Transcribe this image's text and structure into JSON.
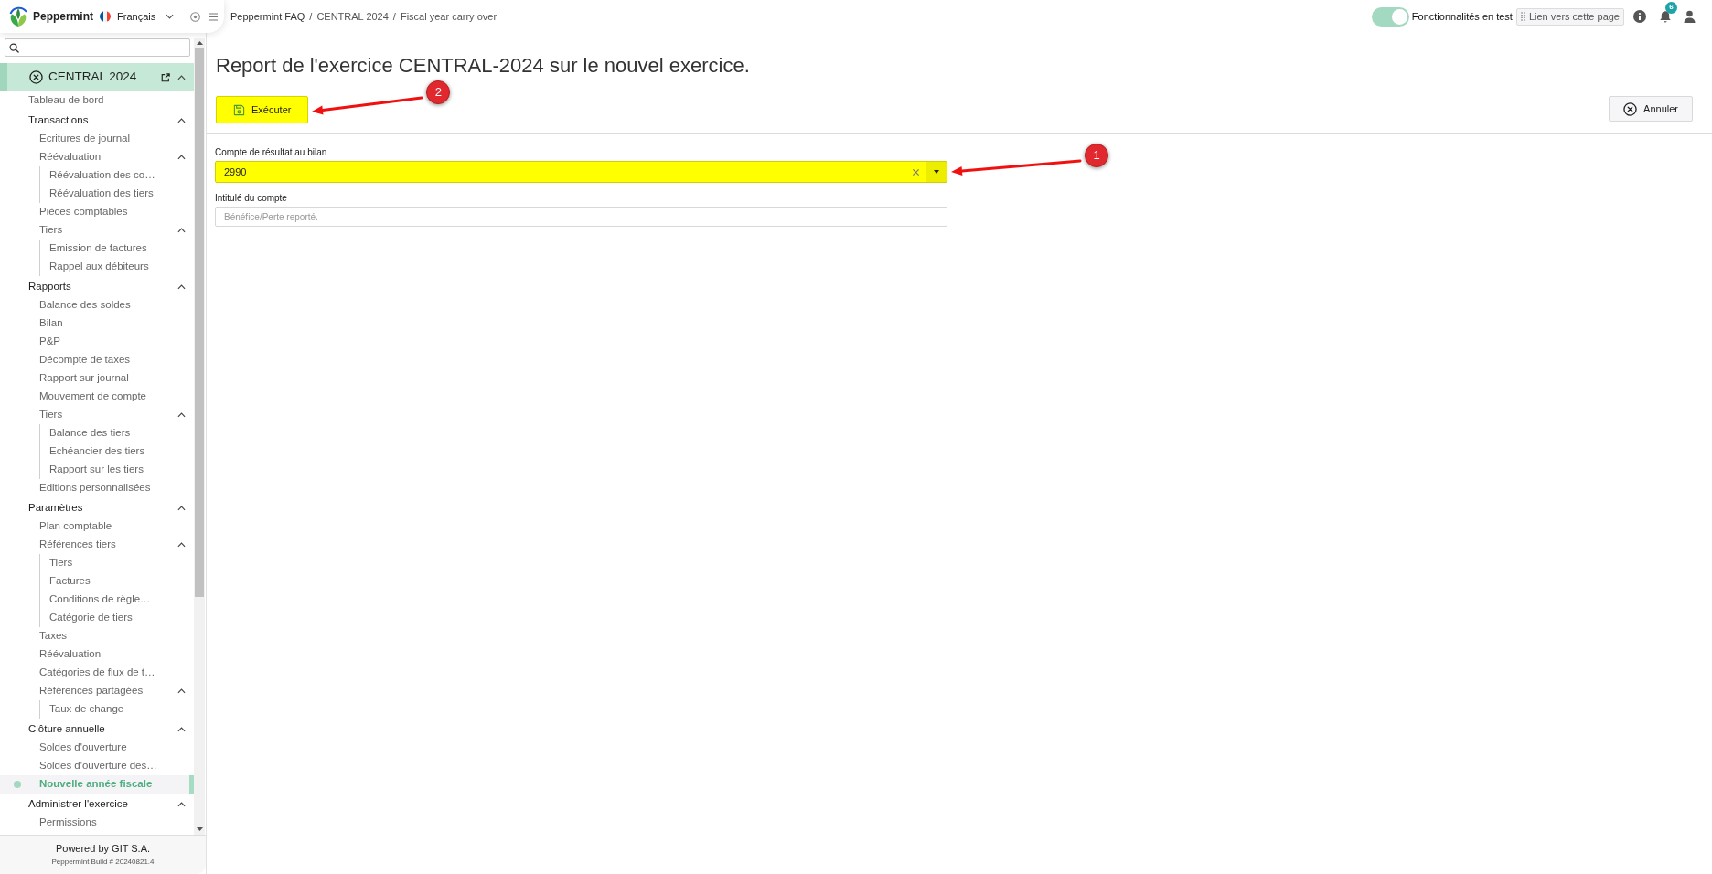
{
  "app": {
    "name": "Peppermint"
  },
  "language": {
    "label": "Français"
  },
  "breadcrumb": {
    "separator": "/",
    "items": [
      {
        "label": "Peppermint FAQ"
      },
      {
        "label": "CENTRAL 2024"
      },
      {
        "label": "Fiscal year carry over"
      }
    ]
  },
  "test_features": {
    "label": "Fonctionnalités en test",
    "on": true
  },
  "page_link": {
    "label": "Lien vers cette page"
  },
  "notifications": {
    "count": "6"
  },
  "sidebar": {
    "section": {
      "label": "CENTRAL 2024",
      "expanded": true,
      "children": [
        {
          "label": "Tableau de bord",
          "kind": "link",
          "selected": false
        },
        {
          "label": "Transactions",
          "kind": "group",
          "selected": false,
          "expanded": true,
          "children": [
            {
              "label": "Ecritures de journal",
              "kind": "link",
              "selected": false
            },
            {
              "label": "Réévaluation",
              "kind": "group",
              "selected": false,
              "expanded": true,
              "children": [
                {
                  "label": "Réévaluation des co…",
                  "kind": "link",
                  "selected": false
                },
                {
                  "label": "Réévaluation des tiers",
                  "kind": "link",
                  "selected": false
                }
              ]
            },
            {
              "label": "Pièces comptables",
              "kind": "link",
              "selected": false
            },
            {
              "label": "Tiers",
              "kind": "group",
              "selected": false,
              "expanded": true,
              "children": [
                {
                  "label": "Emission de factures",
                  "kind": "link",
                  "selected": false
                },
                {
                  "label": "Rappel aux débiteurs",
                  "kind": "link",
                  "selected": false
                }
              ]
            }
          ]
        },
        {
          "label": "Rapports",
          "kind": "group",
          "selected": false,
          "expanded": true,
          "children": [
            {
              "label": "Balance des soldes",
              "kind": "link",
              "selected": false
            },
            {
              "label": "Bilan",
              "kind": "link",
              "selected": false
            },
            {
              "label": "P&P",
              "kind": "link",
              "selected": false
            },
            {
              "label": "Décompte de taxes",
              "kind": "link",
              "selected": false
            },
            {
              "label": "Rapport sur journal",
              "kind": "link",
              "selected": false
            },
            {
              "label": "Mouvement de compte",
              "kind": "link",
              "selected": false
            },
            {
              "label": "Tiers",
              "kind": "group",
              "selected": false,
              "expanded": true,
              "children": [
                {
                  "label": "Balance des tiers",
                  "kind": "link",
                  "selected": false
                },
                {
                  "label": "Echéancier des tiers",
                  "kind": "link",
                  "selected": false
                },
                {
                  "label": "Rapport sur les tiers",
                  "kind": "link",
                  "selected": false
                }
              ]
            },
            {
              "label": "Editions personnalisées",
              "kind": "link",
              "selected": false
            }
          ]
        },
        {
          "label": "Paramètres",
          "kind": "group",
          "selected": false,
          "expanded": true,
          "children": [
            {
              "label": "Plan comptable",
              "kind": "link",
              "selected": false
            },
            {
              "label": "Références tiers",
              "kind": "group",
              "selected": false,
              "expanded": true,
              "children": [
                {
                  "label": "Tiers",
                  "kind": "link",
                  "selected": false
                },
                {
                  "label": "Factures",
                  "kind": "link",
                  "selected": false
                },
                {
                  "label": "Conditions de règle…",
                  "kind": "link",
                  "selected": false
                },
                {
                  "label": "Catégorie de tiers",
                  "kind": "link",
                  "selected": false
                }
              ]
            },
            {
              "label": "Taxes",
              "kind": "link",
              "selected": false
            },
            {
              "label": "Réévaluation",
              "kind": "link",
              "selected": false
            },
            {
              "label": "Catégories de flux de t…",
              "kind": "link",
              "selected": false
            },
            {
              "label": "Références partagées",
              "kind": "group",
              "selected": false,
              "expanded": true,
              "children": [
                {
                  "label": "Taux de change",
                  "kind": "link",
                  "selected": false
                }
              ]
            }
          ]
        },
        {
          "label": "Clôture annuelle",
          "kind": "group",
          "selected": false,
          "expanded": true,
          "children": [
            {
              "label": "Soldes d'ouverture",
              "kind": "link",
              "selected": false
            },
            {
              "label": "Soldes d'ouverture des…",
              "kind": "link",
              "selected": false
            },
            {
              "label": "Nouvelle année fiscale",
              "kind": "link",
              "selected": true
            }
          ]
        },
        {
          "label": "Administrer l'exercice",
          "kind": "group",
          "selected": false,
          "expanded": true,
          "children": [
            {
              "label": "Permissions",
              "kind": "link",
              "selected": false
            }
          ]
        }
      ]
    },
    "footer": {
      "powered_by": "Powered by GIT S.A.",
      "build": "Peppermint Build # 20240821.4"
    }
  },
  "page": {
    "title": "Report de l'exercice CENTRAL-2024 sur le nouvel exercice.",
    "actions": [
      {
        "kind": "execute",
        "label": "Exécuter",
        "highlighted": true,
        "callout": "2"
      },
      {
        "kind": "cancel",
        "label": "Annuler",
        "highlighted": false
      }
    ],
    "fields": [
      {
        "kind": "select",
        "label": "Compte de résultat au bilan",
        "value": "2990",
        "highlighted": true,
        "callout": "1"
      },
      {
        "kind": "text",
        "label": "Intitulé du compte",
        "placeholder": "Bénéfice/Perte reporté.",
        "highlighted": false
      }
    ]
  }
}
